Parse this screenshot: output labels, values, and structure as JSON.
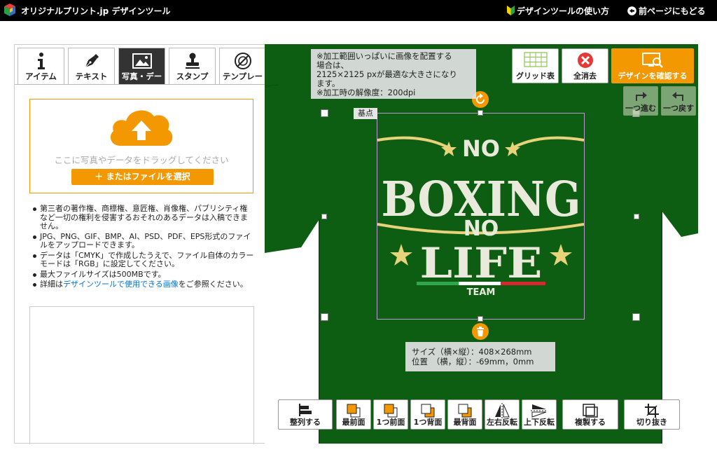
{
  "header": {
    "brand": "オリジナルプリント.jp デザインツール",
    "help_link": "デザインツールの使い方",
    "back_link": "前ページにもどる"
  },
  "tabs": [
    {
      "label": "アイテム",
      "icon": "info-icon"
    },
    {
      "label": "テキスト",
      "icon": "pen-icon"
    },
    {
      "label": "写真・デー",
      "icon": "image-icon",
      "active": true
    },
    {
      "label": "スタンプ",
      "icon": "stamp-icon"
    },
    {
      "label": "テンプレー",
      "icon": "compass-icon"
    }
  ],
  "upload": {
    "drop_text": "ここに写真やデータをドラッグしてください",
    "select_button": "＋ またはファイルを選択",
    "notes": [
      "第三者の著作権、商標権、意匠権、肖像権、パブリシティ権など一切の権利を侵害するおそれのあるデータは入稿できません。",
      "JPG、PNG、GIF、BMP、AI、PSD、PDF、EPS形式のファイルをアップロードできます。",
      "データは「CMYK」で作成したうえで、ファイル自体のカラーモードは「RGB」に設定してください。",
      "最大ファイルサイズは500MBです。"
    ],
    "detail_prefix": "詳細は",
    "detail_link": "デザインツールで使用できる画像",
    "detail_suffix": "をご参照ください。"
  },
  "canvas": {
    "hint_lines": [
      "※加工範囲いっぱいに画像を配置する",
      "場合は、",
      "2125×2125 pxが最適な大きさになり",
      "ます。",
      "※加工時の解像度：200dpi"
    ],
    "origin_label": "基点",
    "size_line": "サイズ（横×縦）：408×268mm",
    "position_line": "位置　（横，縦）：-69mm，0mm",
    "shirt_color": "#0d5e12"
  },
  "design": {
    "line1": "NO",
    "line2": "BOXING",
    "line3": "NO",
    "line4": "LIFE",
    "line5": "TEAM"
  },
  "top_buttons": {
    "grid": "グリッド表",
    "clear": "全消去",
    "confirm": "デザインを確認する",
    "redo": "一つ進む",
    "undo": "一つ戻す"
  },
  "bottom_toolbar": {
    "align": "整列する",
    "front_most": "最前面",
    "forward": "1つ前面",
    "backward": "1つ背面",
    "back_most": "最背面",
    "flip_h": "左右反転",
    "flip_v": "上下反転",
    "duplicate": "複製する",
    "crop": "切り抜き"
  }
}
